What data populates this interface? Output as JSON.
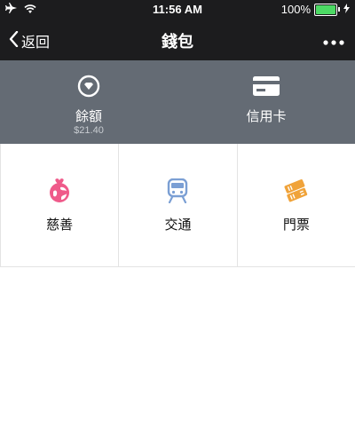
{
  "status_bar": {
    "time": "11:56 AM",
    "battery_percent": "100%",
    "battery_level": 1.0,
    "icons": [
      "airplane-icon",
      "wifi-icon",
      "battery-icon",
      "charging-icon"
    ]
  },
  "nav": {
    "back_label": "返回",
    "title": "錢包",
    "more_icon": "more-dots-icon"
  },
  "wallet": {
    "balance_label": "餘額",
    "balance_amount": "$21.40",
    "credit_card_label": "信用卡"
  },
  "services": [
    {
      "label": "慈善",
      "icon": "charity-icon",
      "color": "#ef5a8a"
    },
    {
      "label": "交通",
      "icon": "transit-icon",
      "color": "#7b9fd4"
    },
    {
      "label": "門票",
      "icon": "ticket-icon",
      "color": "#f0a33a"
    }
  ],
  "colors": {
    "bar_bg": "#1c1c1e",
    "wallet_header_bg": "#646b74",
    "battery_green": "#4cd964"
  }
}
